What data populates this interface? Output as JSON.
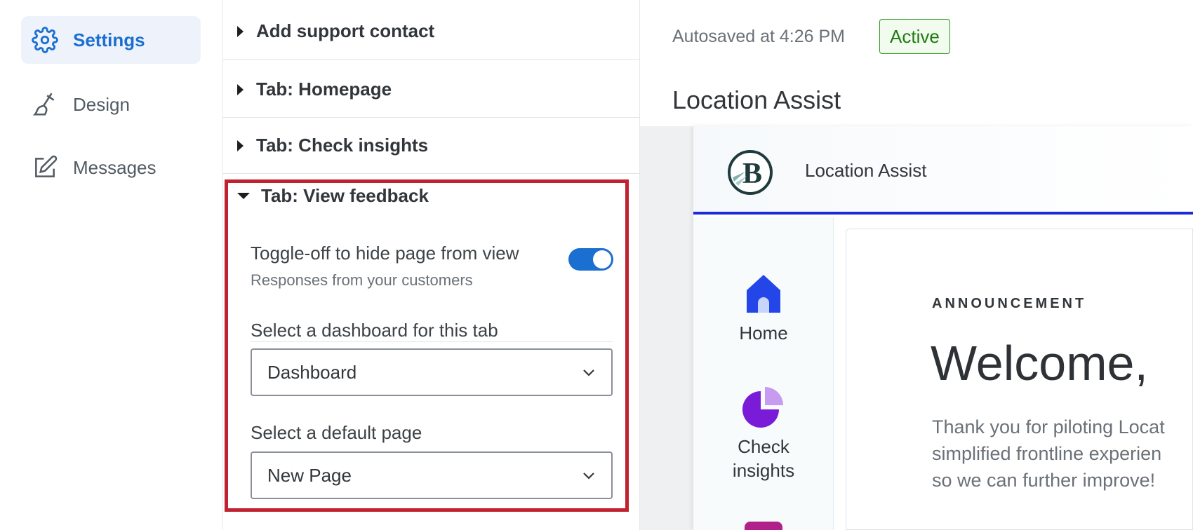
{
  "nav": {
    "items": [
      {
        "label": "Settings",
        "icon": "gear-icon",
        "active": true
      },
      {
        "label": "Design",
        "icon": "paintbrush-icon",
        "active": false
      },
      {
        "label": "Messages",
        "icon": "edit-message-icon",
        "active": false
      }
    ]
  },
  "panel": {
    "sections": [
      {
        "label": "Add support contact",
        "expanded": false
      },
      {
        "label": "Tab: Homepage",
        "expanded": false
      },
      {
        "label": "Tab: Check insights",
        "expanded": false
      }
    ],
    "open_section": {
      "label": "Tab: View feedback",
      "toggle_label": "Toggle-off to hide page from view",
      "toggle_sublabel": "Responses from your customers",
      "toggle_on": true,
      "dashboard_label": "Select a dashboard for this tab",
      "dashboard_value": "Dashboard",
      "default_page_label": "Select a default page",
      "default_page_value": "New Page"
    },
    "highlight_color": "#c0232f"
  },
  "header": {
    "autosave": "Autosaved at 4:26 PM",
    "status": "Active",
    "title": "Location Assist"
  },
  "preview": {
    "app_name": "Location Assist",
    "nav": [
      {
        "label": "Home",
        "icon": "home-icon"
      },
      {
        "label_line1": "Check",
        "label_line2": "insights",
        "icon": "pie-chart-icon"
      }
    ],
    "announcement": "ANNOUNCEMENT",
    "welcome": "Welcome,",
    "body_lines": [
      "Thank you for piloting Locat",
      "simplified frontline experien",
      "so we can further improve!"
    ],
    "accent_color": "#1a2bd9"
  },
  "colors": {
    "primary": "#1b6fd1",
    "status_green": "#217b12"
  }
}
